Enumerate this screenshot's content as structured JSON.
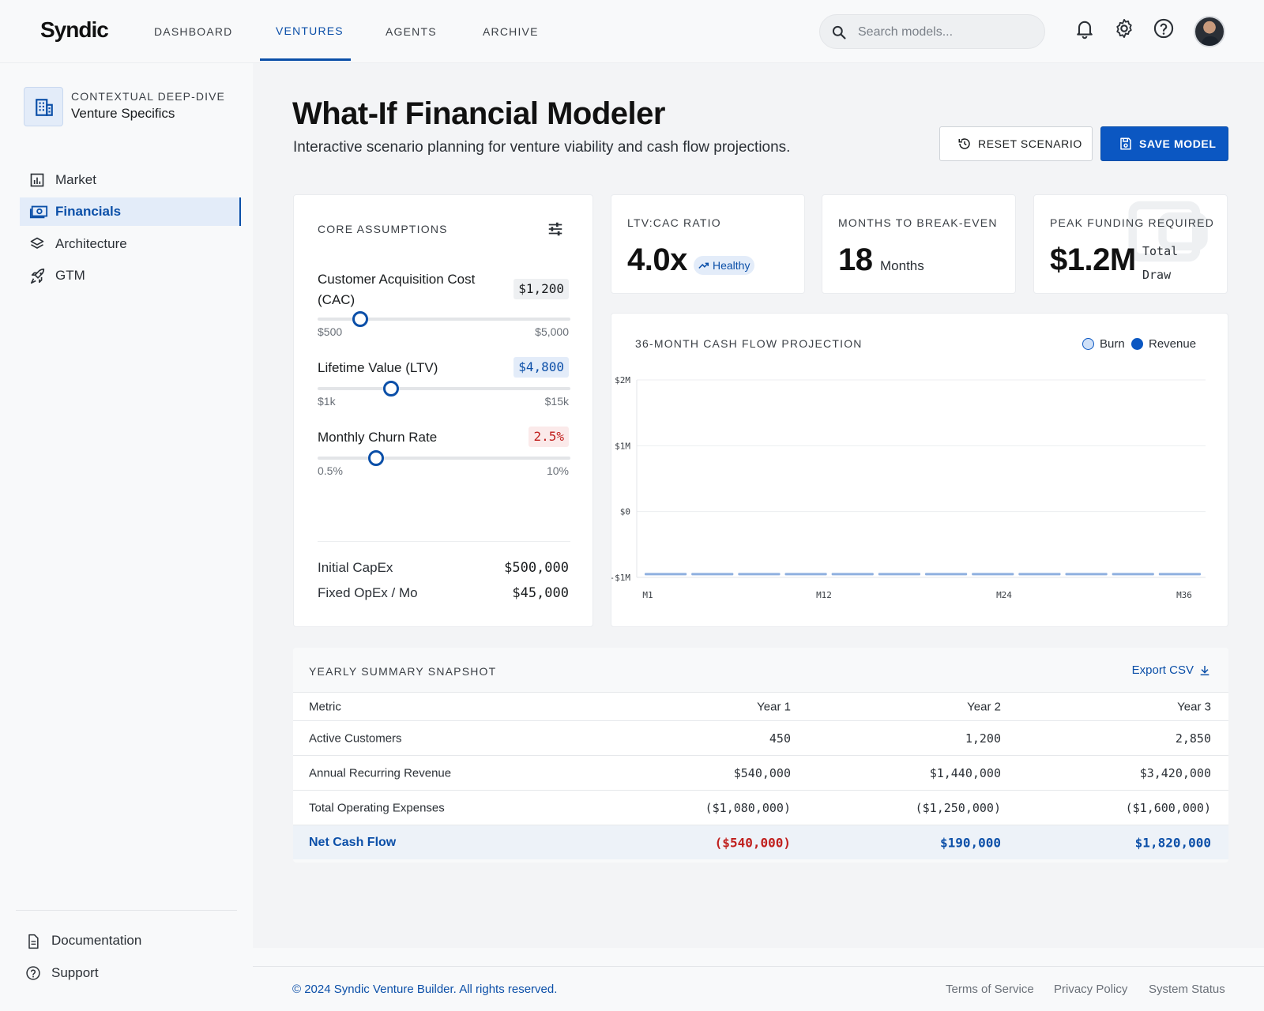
{
  "header": {
    "logo": "Syndic",
    "tabs": [
      {
        "label": "DASHBOARD"
      },
      {
        "label": "VENTURES"
      },
      {
        "label": "AGENTS"
      },
      {
        "label": "ARCHIVE"
      }
    ],
    "active_tab": "VENTURES",
    "search_placeholder": "Search models...",
    "icons": [
      "bell-icon",
      "gear-icon",
      "help-icon"
    ]
  },
  "sidebar": {
    "context_label": "CONTEXTUAL DEEP-DIVE",
    "context_sub": "Venture Specifics",
    "items": [
      {
        "label": "Market",
        "icon": "bar-chart-icon"
      },
      {
        "label": "Financials",
        "icon": "money-icon",
        "active": true
      },
      {
        "label": "Architecture",
        "icon": "layers-icon"
      },
      {
        "label": "GTM",
        "icon": "rocket-icon"
      }
    ],
    "footer_items": [
      {
        "label": "Documentation",
        "icon": "document-icon"
      },
      {
        "label": "Support",
        "icon": "help-icon"
      }
    ]
  },
  "page": {
    "title": "What-If Financial Modeler",
    "subtitle": "Interactive scenario planning for venture viability and cash flow projections.",
    "reset_label": "RESET SCENARIO",
    "save_label": "SAVE MODEL"
  },
  "assumptions": {
    "title": "CORE ASSUMPTIONS",
    "sliders": [
      {
        "label_line1": "Customer Acquisition Cost",
        "label_line2": "(CAC)",
        "value": "$1,200",
        "min": "$500",
        "max": "$5,000",
        "fraction": 0.17
      },
      {
        "label_line1": "Lifetime Value (LTV)",
        "label_line2": "",
        "value": "$4,800",
        "min": "$1k",
        "max": "$15k",
        "fraction": 0.29
      },
      {
        "label_line1": "Monthly Churn Rate",
        "label_line2": "",
        "value": "2.5%",
        "min": "0.5%",
        "max": "10%",
        "fraction": 0.23
      }
    ],
    "capex_label": "Initial CapEx",
    "capex_value": "$500,000",
    "opex_label": "Fixed OpEx / Mo",
    "opex_value": "$45,000"
  },
  "kpis": [
    {
      "title": "LTV:CAC RATIO",
      "value": "4.0x",
      "badge": "Healthy"
    },
    {
      "title": "MONTHS TO BREAK-EVEN",
      "value": "18",
      "unit": "Months"
    },
    {
      "title": "PEAK FUNDING REQUIRED",
      "value": "$1.2M",
      "unit_line1": "Total",
      "unit_line2": "Draw"
    }
  ],
  "chart_data": {
    "type": "bar",
    "title": "36-MONTH CASH FLOW PROJECTION",
    "legend": [
      {
        "name": "Burn",
        "color": "#cfe0f7"
      },
      {
        "name": "Revenue",
        "color": "#0b57c2"
      }
    ],
    "legend_position": "top-right",
    "y_ticks": [
      "$2M",
      "$1M",
      "$0",
      "-$1M"
    ],
    "ylim": [
      -1000000,
      2000000
    ],
    "x_ticks": [
      "M1",
      "M12",
      "M24",
      "M36"
    ],
    "grid": true,
    "series": [
      {
        "name": "Burn",
        "values": [
          -950000,
          -950000,
          -950000,
          -950000,
          -950000,
          -950000,
          -950000,
          -950000,
          -950000,
          -950000,
          -950000,
          -950000
        ]
      }
    ]
  },
  "table": {
    "title": "YEARLY SUMMARY SNAPSHOT",
    "export_label": "Export CSV",
    "columns": [
      "Metric",
      "Year 1",
      "Year 2",
      "Year 3"
    ],
    "rows": [
      {
        "metric": "Active Customers",
        "values": [
          "450",
          "1,200",
          "2,850"
        ]
      },
      {
        "metric": "Annual Recurring Revenue",
        "values": [
          "$540,000",
          "$1,440,000",
          "$3,420,000"
        ]
      },
      {
        "metric": "Total Operating Expenses",
        "values": [
          "($1,080,000)",
          "($1,250,000)",
          "($1,600,000)"
        ]
      }
    ],
    "net_row": {
      "metric": "Net Cash Flow",
      "values": [
        "($540,000)",
        "$190,000",
        "$1,820,000"
      ]
    }
  },
  "footer": {
    "copyright": "© 2024 Syndic Venture Builder. All rights reserved.",
    "links": [
      "Terms of Service",
      "Privacy Policy",
      "System Status"
    ]
  }
}
